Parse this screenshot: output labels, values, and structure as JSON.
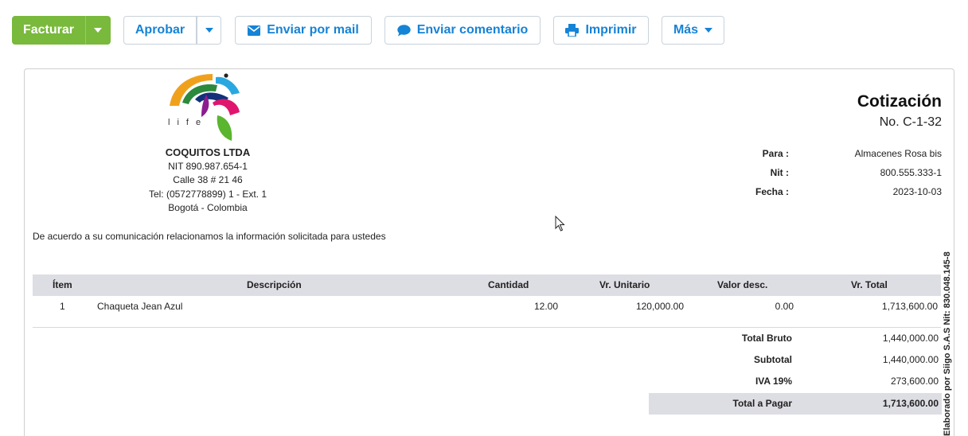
{
  "toolbar": {
    "facturar": "Facturar",
    "aprobar": "Aprobar",
    "enviar_mail": "Enviar por mail",
    "enviar_comentario": "Enviar comentario",
    "imprimir": "Imprimir",
    "mas": "Más",
    "accent_green": "#79b93c",
    "accent_blue": "#1583d6"
  },
  "company": {
    "logo_text": "life",
    "name": "COQUITOS LTDA",
    "nit": "NIT 890.987.654-1",
    "address": "Calle 38 # 21 46",
    "phone": "Tel: (0572778899) 1 - Ext. 1",
    "city": "Bogotá - Colombia"
  },
  "document": {
    "title": "Cotización",
    "number": "No. C-1-32",
    "intro": "De acuerdo a su comunicación relacionamos la información solicitada para ustedes",
    "side_note": "Elaborado por Siigo S.A.S Nit: 830.048.145-8"
  },
  "meta": {
    "para_label": "Para :",
    "para_value": "Almacenes Rosa bis",
    "nit_label": "Nit :",
    "nit_value": "800.555.333-1",
    "fecha_label": "Fecha :",
    "fecha_value": "2023-10-03"
  },
  "table": {
    "headers": [
      "Ítem",
      "Descripción",
      "Cantidad",
      "Vr. Unitario",
      "Valor desc.",
      "Vr. Total"
    ],
    "rows": [
      [
        "1",
        "Chaqueta Jean Azul",
        "12.00",
        "120,000.00",
        "0.00",
        "1,713,600.00"
      ]
    ]
  },
  "totals": {
    "bruto_label": "Total Bruto",
    "bruto_value": "1,440,000.00",
    "subtotal_label": "Subtotal",
    "subtotal_value": "1,440,000.00",
    "iva_label": "IVA 19%",
    "iva_value": "273,600.00",
    "pagar_label": "Total a Pagar",
    "pagar_value": "1,713,600.00"
  },
  "icons": [
    "caret-down-icon",
    "envelope-icon",
    "comment-icon",
    "printer-icon",
    "mouse-cursor-icon"
  ]
}
